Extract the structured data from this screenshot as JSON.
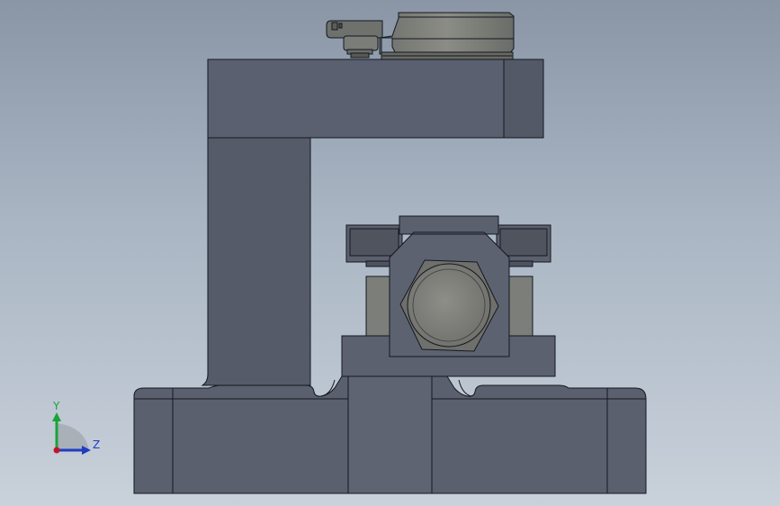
{
  "viewport": {
    "background_top": "#8a96a6",
    "background_bottom": "#c9d1da"
  },
  "model": {
    "body_color": "#5a5f6c",
    "body_dark": "#4c5160",
    "edge_color": "#141820",
    "insert_color": "#7d7f7a",
    "bolt_color": "#8a8b86"
  },
  "triad": {
    "y_label": "Y",
    "z_label": "Z",
    "y_color": "#1aa33a",
    "z_color": "#1f3cc2",
    "origin_color": "#c0182a"
  }
}
